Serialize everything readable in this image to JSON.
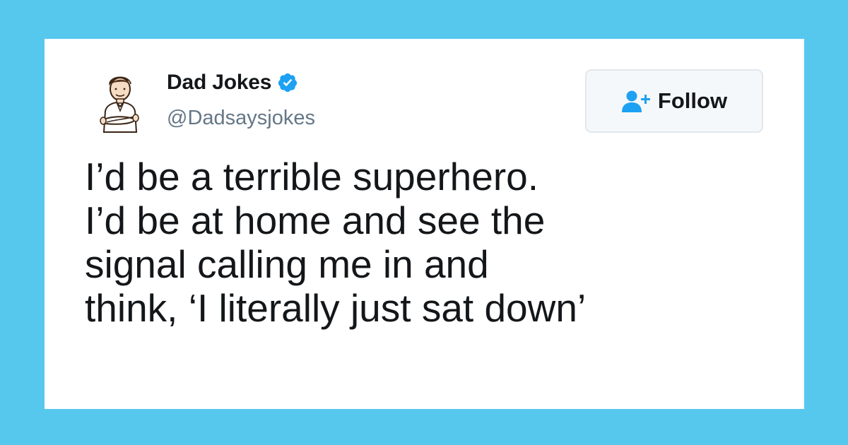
{
  "tweet": {
    "author": {
      "display_name": "Dad Jokes",
      "handle": "@Dadsaysjokes",
      "verified": true,
      "avatar_icon": "cartoon-man-arms-crossed-avatar"
    },
    "follow_button": {
      "label": "Follow",
      "icon": "add-user-icon"
    },
    "text_lines": [
      "I’d be a terrible superhero.",
      "I’d be at home and see the",
      "signal calling me in and",
      "think, ‘I literally just sat down’"
    ]
  },
  "colors": {
    "background": "#56c8ee",
    "card": "#ffffff",
    "verified_badge": "#1da1f2",
    "follow_icon": "#1da1f2",
    "handle_text": "#657786",
    "primary_text": "#14171a"
  }
}
